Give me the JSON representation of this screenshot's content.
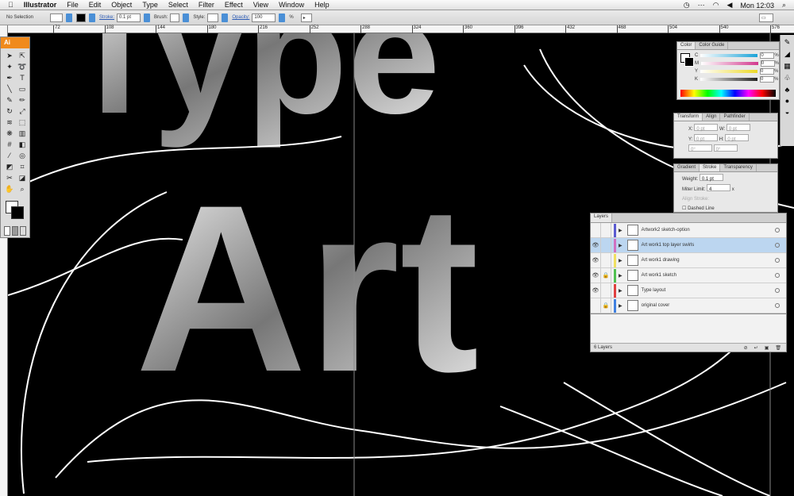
{
  "menubar": {
    "apple": "",
    "app": "Illustrator",
    "items": [
      "File",
      "Edit",
      "Object",
      "Type",
      "Select",
      "Filter",
      "Effect",
      "View",
      "Window",
      "Help"
    ],
    "clock": "Mon 12:03"
  },
  "control": {
    "selection": "No Selection",
    "stroke_label": "Stroke:",
    "stroke_value": "0.1 pt",
    "brush_label": "Brush:",
    "style_label": "Style:",
    "opacity_label": "Opacity:",
    "opacity_value": "100",
    "percent": "%"
  },
  "ruler": {
    "labels": [
      "72",
      "108",
      "144",
      "180",
      "216",
      "252",
      "288",
      "324",
      "360",
      "396",
      "432",
      "468",
      "504",
      "540",
      "576"
    ]
  },
  "toolbox": {
    "logo": "Ai"
  },
  "color_panel": {
    "tabs": [
      "Color",
      "Color Guide"
    ],
    "channels": [
      {
        "k": "C",
        "v": "0",
        "c": "#1ba3d8"
      },
      {
        "k": "M",
        "v": "0",
        "c": "#d2398e"
      },
      {
        "k": "Y",
        "v": "0",
        "c": "#ecd928"
      },
      {
        "k": "K",
        "v": "0",
        "c": "#222222"
      }
    ],
    "unit": "%"
  },
  "transform_panel": {
    "tabs": [
      "Transform",
      "Align",
      "Pathfinder"
    ],
    "x": "X:",
    "y": "Y:",
    "w": "W:",
    "h": "H:",
    "xv": "0 pt",
    "yv": "0 pt",
    "wv": "0 pt",
    "hv": "0 pt",
    "angle": "0°",
    "shear": "0°"
  },
  "stroke_panel": {
    "tabs": [
      "Gradient",
      "Stroke",
      "Transparency"
    ],
    "weight_label": "Weight:",
    "weight_value": "0.1 pt",
    "miter_label": "Miter Limit:",
    "miter_value": "4",
    "miter_unit": "x",
    "align_label": "Align Stroke:",
    "dashed": "Dashed Line"
  },
  "layers_panel": {
    "title": "Layers",
    "footer": "6 Layers",
    "layers": [
      {
        "name": "Artwork2 sketch-option",
        "color": "#5a5ad0",
        "eye": false,
        "lock": false,
        "selected": false
      },
      {
        "name": "Art work1 top layer swirls",
        "color": "#d070c0",
        "eye": true,
        "lock": false,
        "selected": true
      },
      {
        "name": "Art work1 drawing",
        "color": "#f0e060",
        "eye": true,
        "lock": false,
        "selected": false
      },
      {
        "name": "Art work1 sketch",
        "color": "#50c050",
        "eye": true,
        "lock": true,
        "selected": false
      },
      {
        "name": "Type layout",
        "color": "#e04040",
        "eye": true,
        "lock": false,
        "selected": false
      },
      {
        "name": "original cover",
        "color": "#4080e0",
        "eye": false,
        "lock": true,
        "selected": false
      }
    ]
  },
  "artwork": {
    "text_top": "Type",
    "text_bottom": "Art"
  }
}
